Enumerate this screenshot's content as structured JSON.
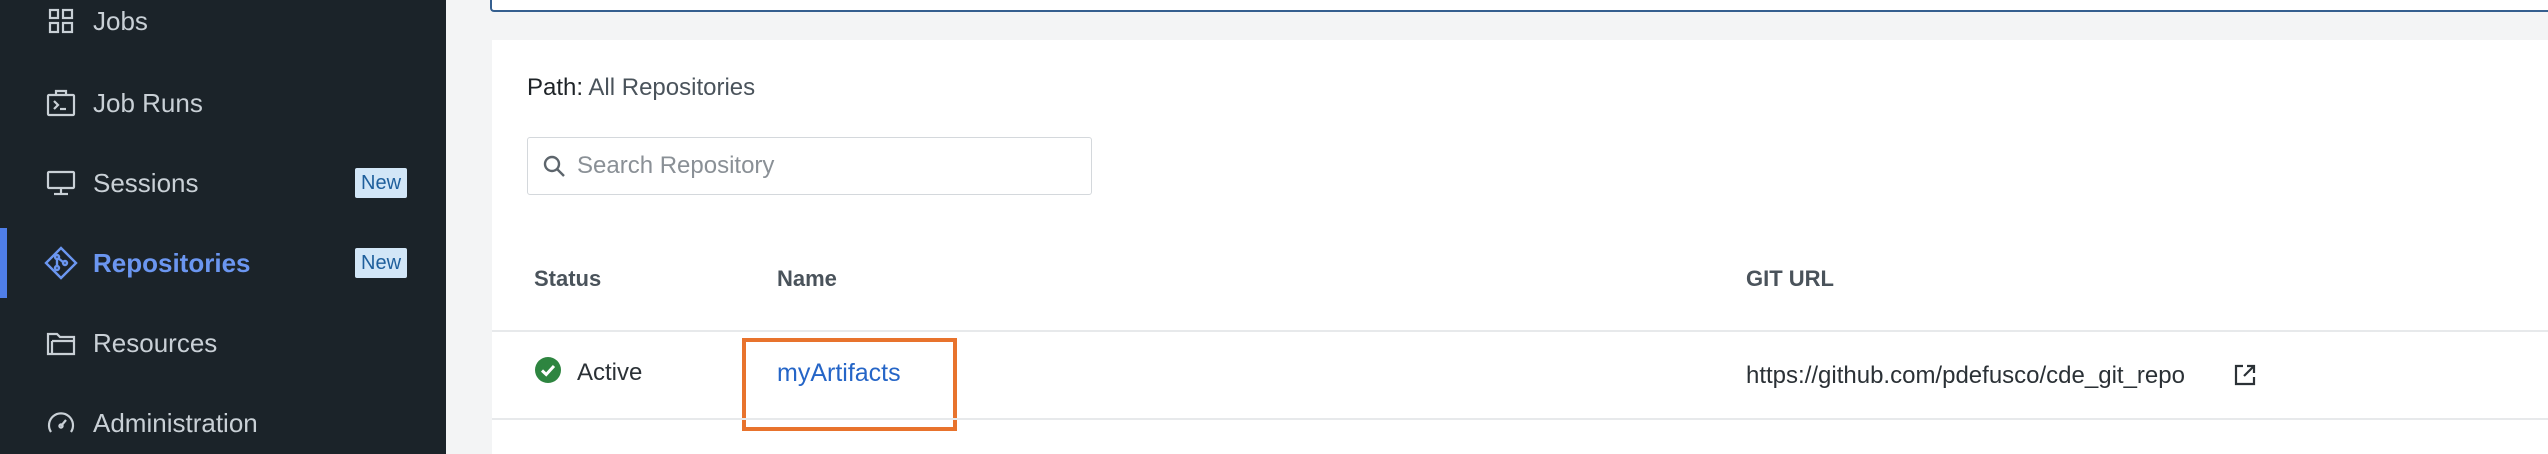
{
  "sidebar": {
    "items": [
      {
        "label": "Jobs",
        "icon": "grid-icon",
        "active": false,
        "badge": ""
      },
      {
        "label": "Job Runs",
        "icon": "terminal-icon",
        "active": false,
        "badge": ""
      },
      {
        "label": "Sessions",
        "icon": "monitor-icon",
        "active": false,
        "badge": "New"
      },
      {
        "label": "Repositories",
        "icon": "git-diamond-icon",
        "active": true,
        "badge": "New"
      },
      {
        "label": "Resources",
        "icon": "folder-icon",
        "active": false,
        "badge": ""
      },
      {
        "label": "Administration",
        "icon": "gauge-icon",
        "active": false,
        "badge": ""
      }
    ]
  },
  "main": {
    "path_label": "Path:",
    "path_value": "All Repositories",
    "search": {
      "placeholder": "Search Repository",
      "value": ""
    },
    "table": {
      "columns": [
        "Status",
        "Name",
        "GIT URL"
      ],
      "rows": [
        {
          "status": "Active",
          "name": "myArtifacts",
          "git_url": "https://github.com/pdefusco/cde_git_repo"
        }
      ]
    }
  },
  "colors": {
    "sidebar_bg": "#1b2329",
    "active_accent": "#4f7ee8",
    "link": "#2565c7",
    "highlight": "#e8732d",
    "status_ok": "#2e8540",
    "badge_bg": "#d2e6f7"
  }
}
